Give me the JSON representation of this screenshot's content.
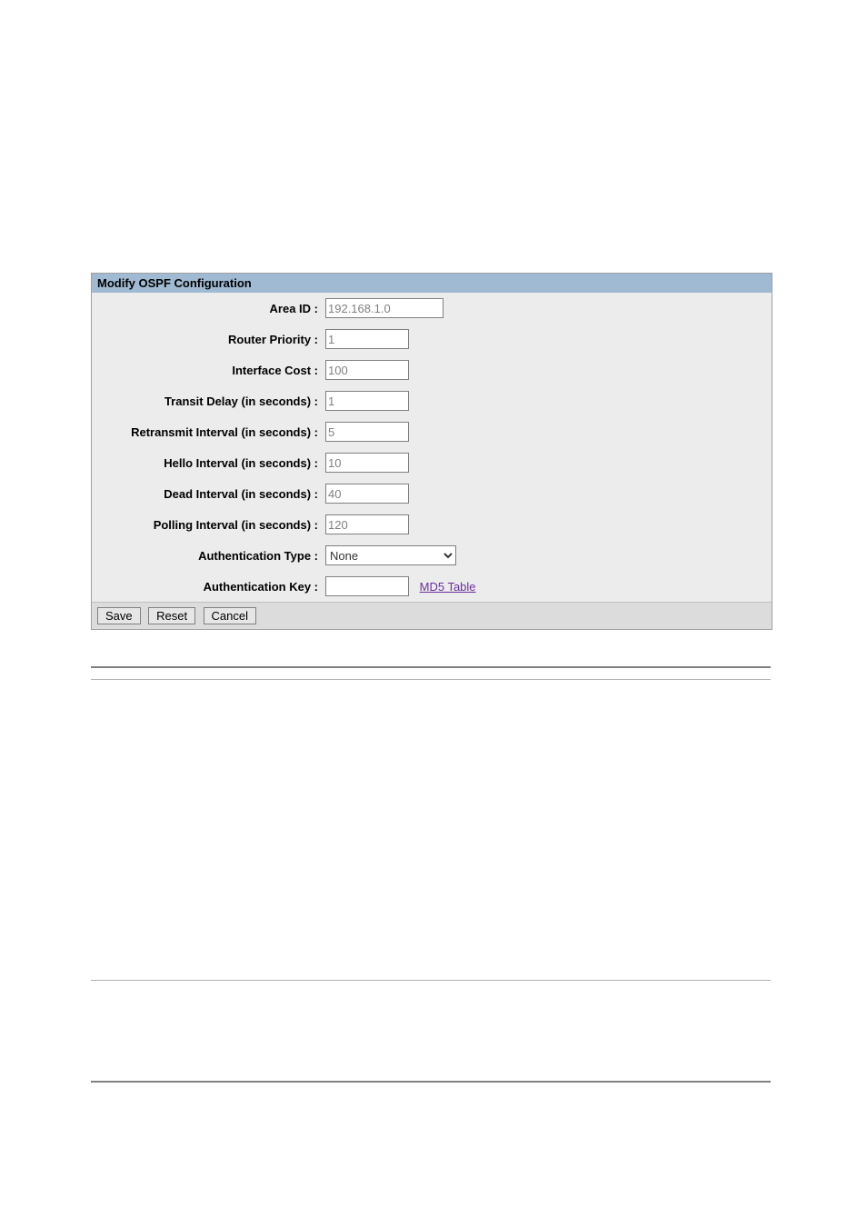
{
  "panel": {
    "title": "Modify OSPF Configuration"
  },
  "fields": {
    "area_id": {
      "label": "Area ID :",
      "value": "192.168.1.0"
    },
    "priority": {
      "label": "Router Priority :",
      "value": "1"
    },
    "cost": {
      "label": "Interface Cost :",
      "value": "100"
    },
    "transit": {
      "label": "Transit Delay (in seconds) :",
      "value": "1"
    },
    "retransmit": {
      "label": "Retransmit Interval (in seconds) :",
      "value": "5"
    },
    "hello": {
      "label": "Hello Interval (in seconds) :",
      "value": "10"
    },
    "dead": {
      "label": "Dead Interval (in seconds) :",
      "value": "40"
    },
    "polling": {
      "label": "Polling Interval (in seconds) :",
      "value": "120"
    },
    "auth_type": {
      "label": "Authentication Type :",
      "value": "None"
    },
    "auth_key": {
      "label": "Authentication Key :",
      "value": ""
    }
  },
  "links": {
    "md5": "MD5 Table"
  },
  "buttons": {
    "save": "Save",
    "reset": "Reset",
    "cancel": "Cancel"
  }
}
